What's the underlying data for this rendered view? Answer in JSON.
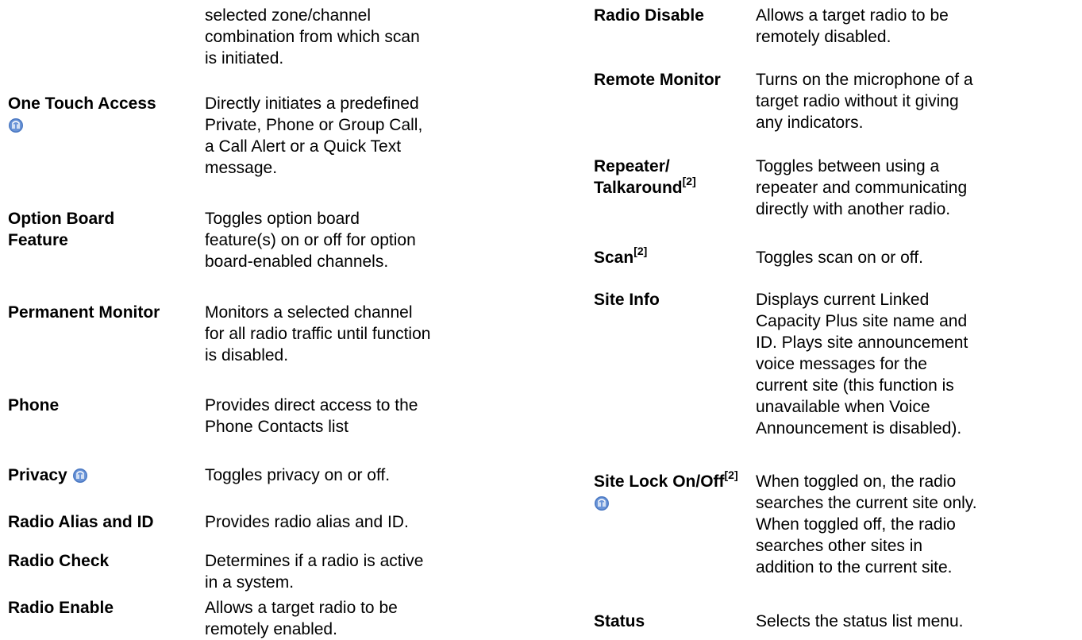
{
  "left_column": {
    "continuation": "selected zone/channel\ncombination from which scan\nis initiated.",
    "entries": [
      {
        "term": "One Touch Access",
        "desc": "Directly initiates a predefined\nPrivate, Phone or Group Call,\na Call Alert or a Quick Text\nmessage."
      },
      {
        "term_line1": "Option Board",
        "term_line2": "Feature",
        "desc": "Toggles option board\nfeature(s) on or off for option\nboard-enabled channels."
      },
      {
        "term": "Permanent Monitor",
        "desc": "Monitors a selected channel\nfor all radio traffic until function\nis disabled."
      },
      {
        "term": "Phone",
        "desc": "Provides direct access to the\nPhone Contacts list"
      },
      {
        "term": "Privacy",
        "desc": "Toggles privacy on or off."
      },
      {
        "term": "Radio Alias and ID",
        "desc": "Provides radio alias and ID."
      },
      {
        "term": "Radio Check",
        "desc": "Determines if a radio is active\nin a system."
      },
      {
        "term": "Radio Enable",
        "desc": "Allows a target radio to be\nremotely enabled."
      }
    ]
  },
  "right_column": {
    "entries": [
      {
        "term": "Radio Disable",
        "desc": "Allows a target radio to be\nremotely disabled."
      },
      {
        "term": "Remote Monitor",
        "desc": "Turns on the microphone of a\ntarget radio without it giving\nany indicators."
      },
      {
        "term_line1": "Repeater/",
        "term_line2": "Talkaround",
        "sup": "[2]",
        "desc": "Toggles between using a\nrepeater and communicating\ndirectly with another radio."
      },
      {
        "term": "Scan",
        "sup": "[2]",
        "desc": "Toggles scan on or off."
      },
      {
        "term": "Site Info",
        "desc": "Displays current Linked\nCapacity Plus site name and\nID. Plays site announcement\nvoice messages for the\ncurrent site (this function is\nunavailable when Voice\nAnnouncement is disabled)."
      },
      {
        "term": "Site Lock On/Off",
        "sup": "[2]",
        "desc": "When toggled on, the radio\nsearches the current site only.\nWhen toggled off, the radio\nsearches other sites in\naddition to the current site."
      },
      {
        "term": "Status",
        "desc": "Selects the status list menu."
      }
    ]
  },
  "icons": {
    "programmable_icon": "programmable-button-icon",
    "icon_color": "#4a78c2"
  }
}
